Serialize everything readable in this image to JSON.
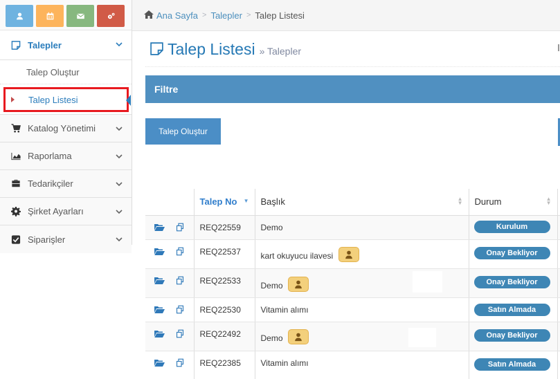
{
  "colors": {
    "accent": "#2b7dbc",
    "filter_bar": "#5090c1",
    "button": "#4b8ec6",
    "status": "#3e86b5",
    "highlight_border": "#e8191f"
  },
  "shortcuts": [
    {
      "name": "user-icon",
      "color": "#6fb3e0"
    },
    {
      "name": "calendar-icon",
      "color": "#fdb45c"
    },
    {
      "name": "envelope-icon",
      "color": "#87b87f"
    },
    {
      "name": "cogs-icon",
      "color": "#d15b47"
    }
  ],
  "sidebar": {
    "talepler": {
      "label": "Talepler",
      "icon": "note-icon"
    },
    "submenu": [
      {
        "label": "Talep Oluştur"
      },
      {
        "label": "Talep Listesi"
      }
    ],
    "items": [
      {
        "label": "Katalog Yönetimi",
        "icon": "cart-icon"
      },
      {
        "label": "Raporlama",
        "icon": "area-chart-icon"
      },
      {
        "label": "Tedarikçiler",
        "icon": "briefcase-icon"
      },
      {
        "label": "Şirket Ayarları",
        "icon": "gear-icon"
      },
      {
        "label": "Siparişler",
        "icon": "check-square-icon"
      }
    ]
  },
  "breadcrumb": {
    "home": "Ana Sayfa",
    "section": "Talepler",
    "current": "Talep Listesi"
  },
  "page": {
    "title": "Talep Listesi",
    "subtitle": "» Talepler"
  },
  "filter": {
    "label": "Filtre"
  },
  "toolbar": {
    "create_label": "Talep Oluştur"
  },
  "table": {
    "headers": {
      "no": "Talep No",
      "title": "Başlık",
      "status": "Durum"
    },
    "rows": [
      {
        "no": "REQ22559",
        "title": "Demo",
        "status": "Kurulum"
      },
      {
        "no": "REQ22537",
        "title": "kart okuyucu ilavesi",
        "status": "Onay Bekliyor"
      },
      {
        "no": "REQ22533",
        "title": "Demo",
        "status": "Onay Bekliyor"
      },
      {
        "no": "REQ22530",
        "title": "Vitamin alımı",
        "status": "Satın Almada"
      },
      {
        "no": "REQ22492",
        "title": "Demo",
        "status": "Onay Bekliyor"
      },
      {
        "no": "REQ22385",
        "title": "Vitamin alımı",
        "status": "Satın Almada"
      }
    ]
  }
}
